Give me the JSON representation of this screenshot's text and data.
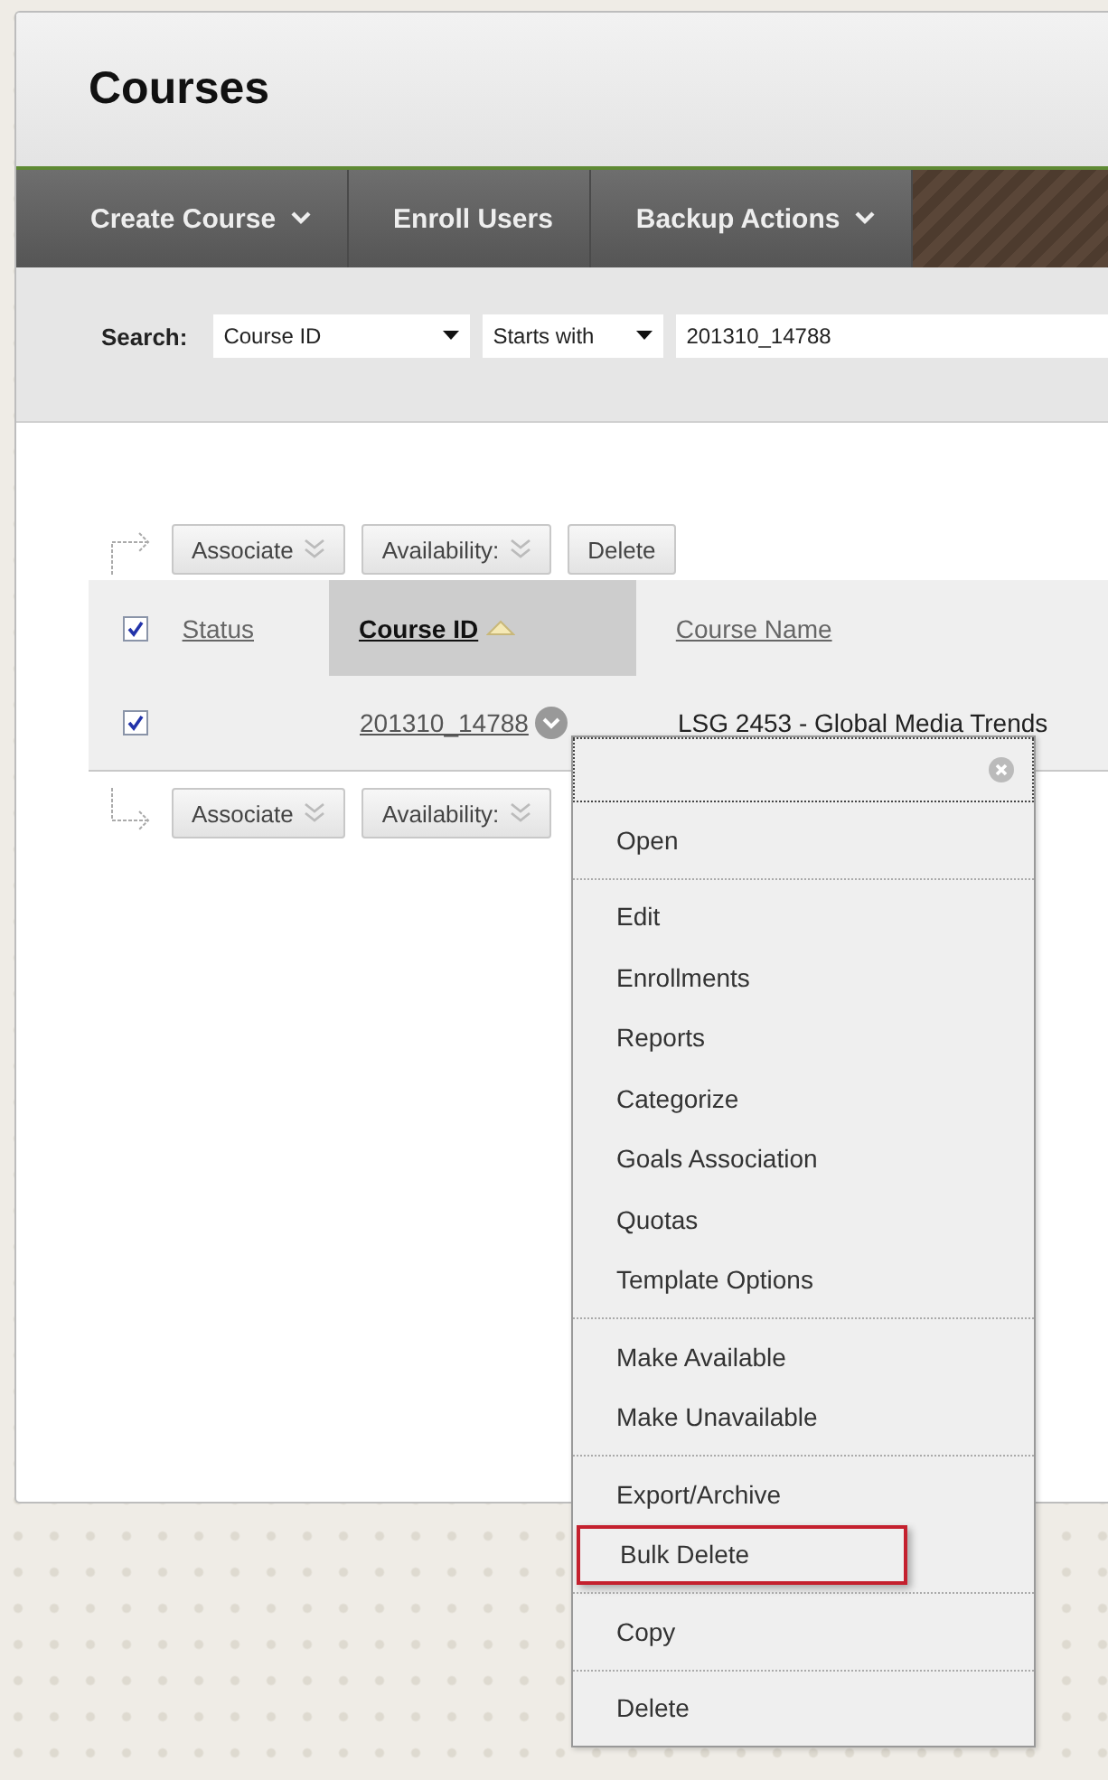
{
  "page_title": "Courses",
  "nav": [
    {
      "label": "Create Course",
      "dropdown": true
    },
    {
      "label": "Enroll Users",
      "dropdown": false
    },
    {
      "label": "Backup Actions",
      "dropdown": true
    }
  ],
  "search": {
    "label": "Search:",
    "field": "Course ID",
    "operator": "Starts with",
    "value": "201310_14788"
  },
  "top_actions": [
    {
      "label": "Associate",
      "dropdown": true
    },
    {
      "label": "Availability:",
      "dropdown": true
    },
    {
      "label": "Delete",
      "dropdown": false
    }
  ],
  "table": {
    "select_all_checked": true,
    "columns": [
      {
        "label": "Status",
        "sorted": false
      },
      {
        "label": "Course ID",
        "sorted": true
      },
      {
        "label": "Course Name",
        "sorted": false
      }
    ],
    "rows": [
      {
        "checked": true,
        "course_id": "201310_14788",
        "course_name": "LSG 2453 - Global Media Trends"
      }
    ]
  },
  "bottom_actions": [
    {
      "label": "Associate",
      "dropdown": true
    },
    {
      "label": "Availability:",
      "dropdown": true
    }
  ],
  "context_menu": {
    "groups": [
      [
        {
          "label": "Open",
          "highlighted": false
        }
      ],
      [
        {
          "label": "Edit",
          "highlighted": false
        },
        {
          "label": "Enrollments",
          "highlighted": false
        },
        {
          "label": "Reports",
          "highlighted": false
        },
        {
          "label": "Categorize",
          "highlighted": false
        },
        {
          "label": "Goals Association",
          "highlighted": false
        },
        {
          "label": "Quotas",
          "highlighted": false
        },
        {
          "label": "Template Options",
          "highlighted": false
        }
      ],
      [
        {
          "label": "Make Available",
          "highlighted": false
        },
        {
          "label": "Make Unavailable",
          "highlighted": false
        }
      ],
      [
        {
          "label": "Export/Archive",
          "highlighted": false
        },
        {
          "label": "Bulk Delete",
          "highlighted": true
        }
      ],
      [
        {
          "label": "Copy",
          "highlighted": false
        }
      ],
      [
        {
          "label": "Delete",
          "highlighted": false
        }
      ]
    ]
  }
}
